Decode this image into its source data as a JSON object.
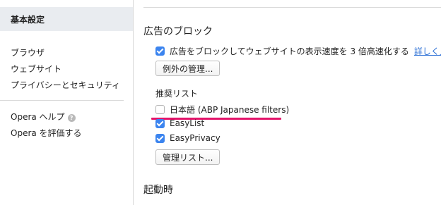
{
  "sidebar": {
    "active_item": "基本設定",
    "items": [
      {
        "label": "ブラウザ"
      },
      {
        "label": "ウェブサイト"
      },
      {
        "label": "プライバシーとセキュリティ"
      }
    ],
    "help_label": "Opera ヘルプ",
    "help_icon_glyph": "?",
    "rate_label": "Opera を評価する"
  },
  "main": {
    "ad_block": {
      "title": "広告のブロック",
      "enable_label": "広告をブロックしてウェブサイトの表示速度を 3 倍高速化する",
      "enable_checked": true,
      "learn_more": "詳しく見る",
      "exceptions_button": "例外の管理...",
      "lists_label": "推奨リスト",
      "lists": [
        {
          "label": "日本語 (ABP Japanese filters)",
          "checked": false
        },
        {
          "label": "EasyList",
          "checked": true
        },
        {
          "label": "EasyPrivacy",
          "checked": true
        }
      ],
      "manage_button": "管理リスト..."
    },
    "startup": {
      "title": "起動時"
    }
  },
  "colors": {
    "accent": "#3b84ef",
    "link": "#2f72d6",
    "highlight_underline": "#e3146a",
    "sidebar_active_bg": "#e9ecf0"
  }
}
